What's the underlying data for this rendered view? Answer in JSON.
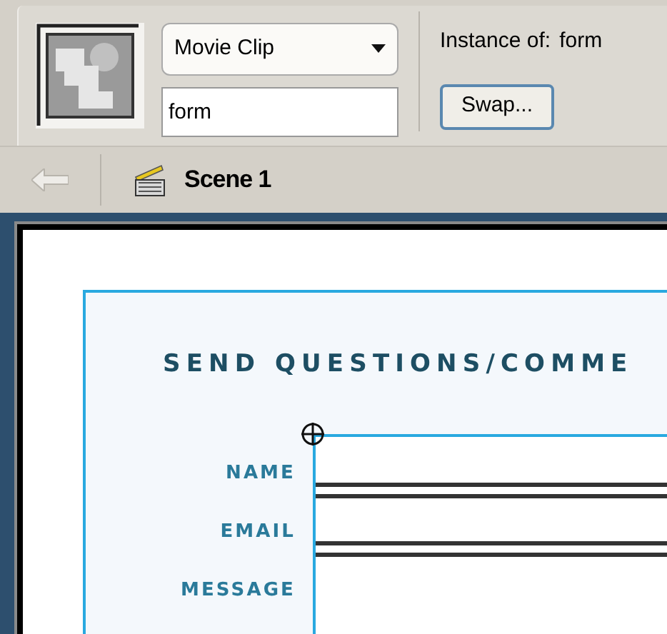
{
  "properties": {
    "symbol_type": "Movie Clip",
    "instance_name": "form",
    "instance_of_label": "Instance of:",
    "instance_of_value": "form",
    "swap_button": "Swap..."
  },
  "edit_bar": {
    "back_disabled": true,
    "scene": "Scene 1"
  },
  "stage": {
    "title": "SEND QUESTIONS/COMME",
    "fields": [
      {
        "label": "NAME"
      },
      {
        "label": "EMAIL"
      },
      {
        "label": "MESSAGE"
      }
    ]
  }
}
